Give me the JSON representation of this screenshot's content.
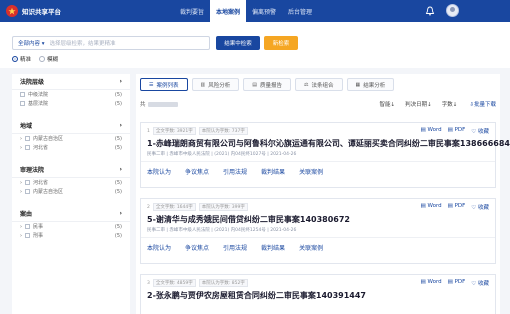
{
  "app": {
    "brand": "知识共享平台",
    "nav": [
      "裁判要旨",
      "本地案例",
      "偏离预警",
      "后台管理"
    ],
    "active_nav_index": 1
  },
  "search": {
    "scope": "全部内容 ▾",
    "placeholder": "选择层级检索，结果更精准",
    "result_search_label": "结果中检索",
    "new_search_label": "新检索",
    "mode_exact": "精准",
    "mode_fuzzy": "模糊",
    "selected_mode": "exact"
  },
  "sidebar": {
    "facets": [
      {
        "title": "法院层级",
        "items": [
          {
            "label": "中级法院",
            "count": "(5)"
          },
          {
            "label": "基层法院",
            "count": "(5)"
          }
        ]
      },
      {
        "title": "地域",
        "items": [
          {
            "label": "内蒙古自治区",
            "count": "(5)"
          },
          {
            "label": "河北省",
            "count": "(5)"
          }
        ]
      },
      {
        "title": "审理法院",
        "items": [
          {
            "label": "河北省",
            "count": "(5)"
          },
          {
            "label": "内蒙古自治区",
            "count": "(5)"
          }
        ]
      },
      {
        "title": "案由",
        "items": [
          {
            "label": "民事",
            "count": "(5)"
          },
          {
            "label": "刑事",
            "count": "(5)"
          }
        ]
      }
    ]
  },
  "main": {
    "tabs": [
      "案例列表",
      "风险分析",
      "质量报告",
      "法条组合",
      "结果分析"
    ],
    "active_tab_index": 0,
    "count_prefix": "共",
    "sort_smart": "智能",
    "sort_date": "判决日期",
    "sort_words": "字数",
    "download": "批量下载",
    "card_actions": [
      "Word",
      "PDF",
      "收藏"
    ],
    "card_links": [
      "本院认为",
      "争议焦点",
      "引用法规",
      "裁判结果",
      "关联案例"
    ],
    "cards": [
      {
        "index": "1",
        "meta1": "全文字数: 3921字",
        "meta2": "本院认为字数: 737字",
        "title": "1-赤峰瑞朗商贸有限公司与阿鲁科尔沁旗运通有限公司、谭延丽买卖合同纠纷二审民事案138666684",
        "sub": "民事二审 | 赤峰市中级人民法院 | (2021) 内04民终1027号 | 2021-04-26"
      },
      {
        "index": "2",
        "meta1": "全文字数: 1644字",
        "meta2": "本院认为字数: 399字",
        "title": "5-谢清华与成秀娥民间借贷纠纷二审民事案140380672",
        "sub": "民事二审 | 赤峰市中级人民法院 | (2021) 内04民终1254号 | 2021-04-26"
      },
      {
        "index": "3",
        "meta1": "全文字数: 4859字",
        "meta2": "本院认为字数: 852字",
        "title": "2-张永鹏与贾伊农房屋租赁合同纠纷二审民事案140391447",
        "sub": ""
      }
    ]
  },
  "colors": {
    "primary": "#1947a0",
    "accent": "#f5a623",
    "brand_red": "#d9302c"
  }
}
